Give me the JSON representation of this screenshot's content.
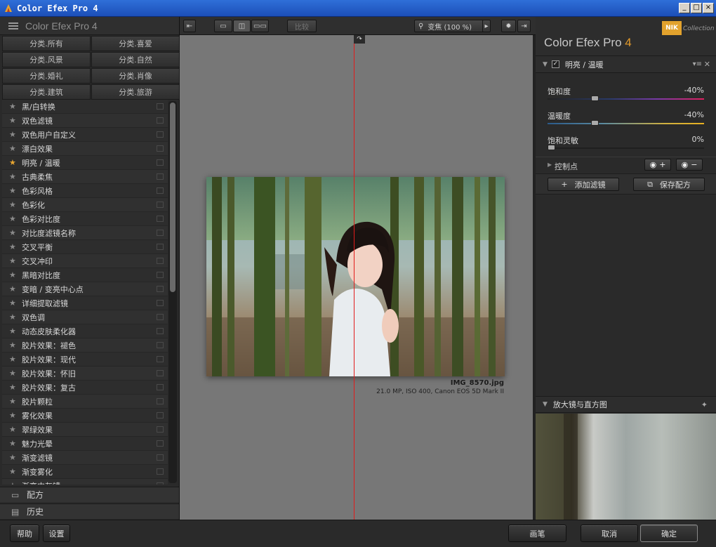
{
  "window": {
    "title": "Color Efex Pro 4",
    "min": "_",
    "max": "□",
    "close": "×"
  },
  "left": {
    "header_title": "Color Efex Pro 4",
    "categories": [
      "分类.所有",
      "分类.喜爱",
      "分类.风景",
      "分类.自然",
      "分类.婚礼",
      "分类.肖像",
      "分类.建筑",
      "分类.旅游"
    ],
    "filters": [
      {
        "name": "黑/白转换",
        "fav": false
      },
      {
        "name": "双色滤镜",
        "fav": false
      },
      {
        "name": "双色用户自定义",
        "fav": false
      },
      {
        "name": "漂白效果",
        "fav": false
      },
      {
        "name": "明亮 / 温暖",
        "fav": true
      },
      {
        "name": "古典柔焦",
        "fav": false
      },
      {
        "name": "色彩风格",
        "fav": false
      },
      {
        "name": "色彩化",
        "fav": false
      },
      {
        "name": "色彩对比度",
        "fav": false
      },
      {
        "name": "对比度滤镜名称",
        "fav": false
      },
      {
        "name": "交叉平衡",
        "fav": false
      },
      {
        "name": "交叉冲印",
        "fav": false
      },
      {
        "name": "黑暗对比度",
        "fav": false
      },
      {
        "name": "变暗 / 变亮中心点",
        "fav": false
      },
      {
        "name": "详细提取滤镜",
        "fav": false
      },
      {
        "name": "双色调",
        "fav": false
      },
      {
        "name": "动态皮肤柔化器",
        "fav": false
      },
      {
        "name": "胶片效果：褪色",
        "fav": false
      },
      {
        "name": "胶片效果：现代",
        "fav": false
      },
      {
        "name": "胶片效果：怀旧",
        "fav": false
      },
      {
        "name": "胶片效果：复古",
        "fav": false
      },
      {
        "name": "胶片颗粒",
        "fav": false
      },
      {
        "name": "雾化效果",
        "fav": false
      },
      {
        "name": "翠绿效果",
        "fav": false
      },
      {
        "name": "魅力光晕",
        "fav": false
      },
      {
        "name": "渐变滤镜",
        "fav": false
      },
      {
        "name": "渐变雾化",
        "fav": false
      },
      {
        "name": "渐变中灰镜",
        "fav": false
      }
    ],
    "recipes_label": "配方",
    "history_label": "历史"
  },
  "toolbar": {
    "compare_label": "比较",
    "zoom_label": "变焦 (100 %)"
  },
  "canvas": {
    "image_name": "IMG_8570.jpg",
    "image_meta": "21.0 MP, ISO 400, Canon EOS 5D Mark II"
  },
  "right": {
    "logo_text": "Color Efex Pro ",
    "logo_num": "4",
    "nik_badge": "NIK",
    "nik_collection": "Collection",
    "filter_title": "明亮 / 温暖",
    "sliders": [
      {
        "label": "饱和度",
        "value": "-40%",
        "pos": 0.3
      },
      {
        "label": "温暖度",
        "value": "-40%",
        "pos": 0.3
      },
      {
        "label": "饱和灵敏",
        "value": "0%",
        "pos": 0.0
      }
    ],
    "control_points": "控制点",
    "add_filter": "添加滤镜",
    "save_recipe": "保存配方",
    "loupe_title": "放大镜与直方图"
  },
  "bottom": {
    "help": "帮助",
    "settings": "设置",
    "brush": "画笔",
    "cancel": "取消",
    "ok": "确定"
  },
  "colors": {
    "accent": "#e39a2b",
    "split_line": "#e21b1b",
    "canvas_bg": "#777777"
  }
}
